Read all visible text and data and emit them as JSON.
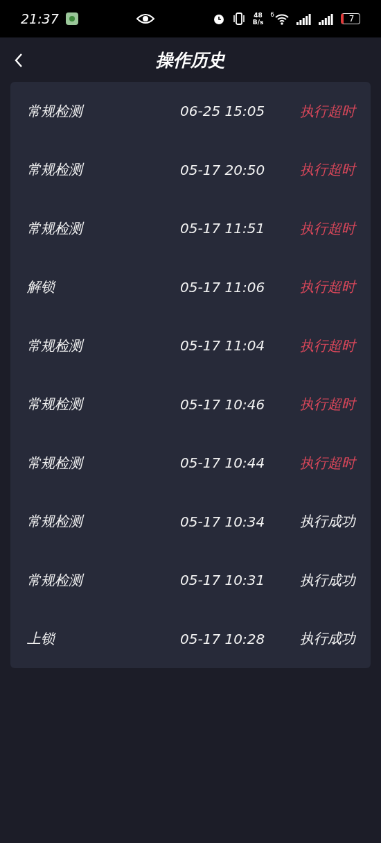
{
  "status_bar": {
    "time": "21:37",
    "net_speed": {
      "value": "48",
      "unit": "B/s"
    },
    "wifi_badge": "6",
    "battery": {
      "text": "7",
      "low": true
    }
  },
  "header": {
    "title": "操作历史"
  },
  "history": [
    {
      "action": "常规检测",
      "time": "06-25 15:05",
      "result": "执行超时",
      "color": "#d9475a"
    },
    {
      "action": "常规检测",
      "time": "05-17 20:50",
      "result": "执行超时",
      "color": "#d9475a"
    },
    {
      "action": "常规检测",
      "time": "05-17 11:51",
      "result": "执行超时",
      "color": "#d9475a"
    },
    {
      "action": "解锁",
      "time": "05-17 11:06",
      "result": "执行超时",
      "color": "#d9475a"
    },
    {
      "action": "常规检测",
      "time": "05-17 11:04",
      "result": "执行超时",
      "color": "#d9475a"
    },
    {
      "action": "常规检测",
      "time": "05-17 10:46",
      "result": "执行超时",
      "color": "#d9475a"
    },
    {
      "action": "常规检测",
      "time": "05-17 10:44",
      "result": "执行超时",
      "color": "#d9475a"
    },
    {
      "action": "常规检测",
      "time": "05-17 10:34",
      "result": "执行成功",
      "color": "#f2f2f2"
    },
    {
      "action": "常规检测",
      "time": "05-17 10:31",
      "result": "执行成功",
      "color": "#f2f2f2"
    },
    {
      "action": "上锁",
      "time": "05-17 10:28",
      "result": "执行成功",
      "color": "#f2f2f2"
    }
  ]
}
